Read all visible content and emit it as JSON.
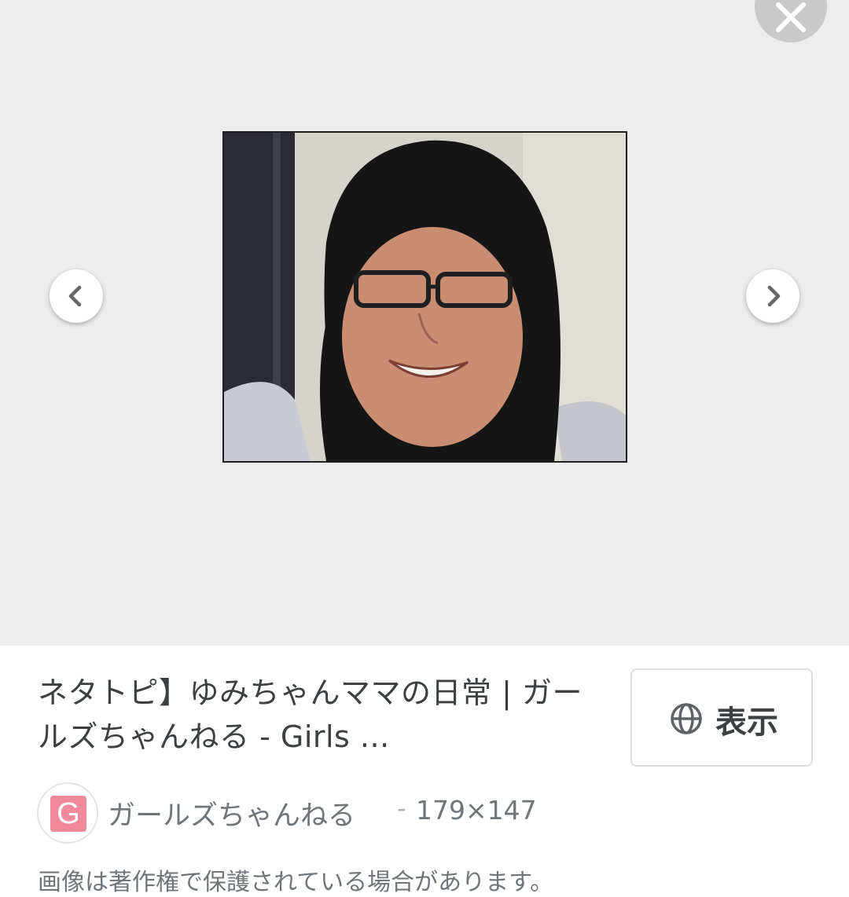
{
  "viewer": {
    "close_icon": "close-icon",
    "prev_icon": "chevron-left-icon",
    "next_icon": "chevron-right-icon",
    "image_alt": "man with long black hair and glasses smiling"
  },
  "result": {
    "title": "ネタトピ】ゆみちゃんママの日常 | ガールズちゃんねる - Girls ...",
    "view_button_label": "表示",
    "view_button_icon": "globe-icon",
    "favicon_letter": "G",
    "favicon_color": "#f08a9b",
    "source_name": "ガールズちゃんねる",
    "separator": "-",
    "dimensions": "179×147",
    "notice": "画像は著作権で保護されている場合があります。"
  }
}
